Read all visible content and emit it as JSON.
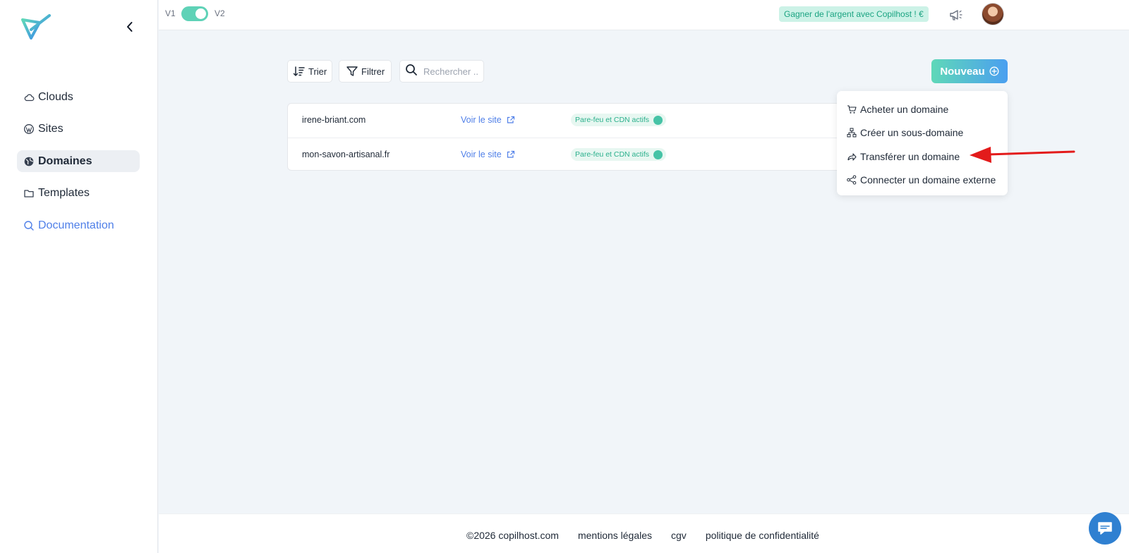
{
  "topbar": {
    "v1_label": "V1",
    "v2_label": "V2",
    "version_toggle_on": true,
    "earn_label": "Gagner de l'argent avec Copilhost ! €",
    "notification_icon": "megaphone-icon",
    "avatar": "user-avatar"
  },
  "sidebar": {
    "items": [
      {
        "label": "Clouds",
        "icon": "cloud-icon"
      },
      {
        "label": "Sites",
        "icon": "wordpress-icon"
      },
      {
        "label": "Domaines",
        "icon": "globe-icon",
        "active": true
      },
      {
        "label": "Templates",
        "icon": "folder-icon"
      },
      {
        "label": "Documentation",
        "icon": "search-icon"
      }
    ]
  },
  "toolbar": {
    "sort_label": "Trier",
    "filter_label": "Filtrer",
    "search_placeholder": "Rechercher ..",
    "new_label": "Nouveau"
  },
  "domains": [
    {
      "name": "irene-briant.com",
      "visit_label": "Voir le site",
      "status": "Pare-feu et CDN actifs"
    },
    {
      "name": "mon-savon-artisanal.fr",
      "visit_label": "Voir le site",
      "status": "Pare-feu et CDN actifs"
    }
  ],
  "dropdown": {
    "items": [
      {
        "label": "Acheter un domaine",
        "icon": "cart-icon"
      },
      {
        "label": "Créer un sous-domaine",
        "icon": "sitemap-icon"
      },
      {
        "label": "Transférer un domaine",
        "icon": "share-arrow-icon"
      },
      {
        "label": "Connecter un domaine externe",
        "icon": "connect-nodes-icon"
      }
    ]
  },
  "footer": {
    "copyright": "©2026 copilhost.com",
    "mentions": "mentions légales",
    "cgv": "cgv",
    "privacy": "politique de confidentialité"
  },
  "colors": {
    "accent_green": "#5fd2b7",
    "accent_blue": "#4b9ff0",
    "link_blue": "#4f7fe8",
    "annotation_red": "#e31b1b",
    "chat_blue": "#2f80d1"
  }
}
